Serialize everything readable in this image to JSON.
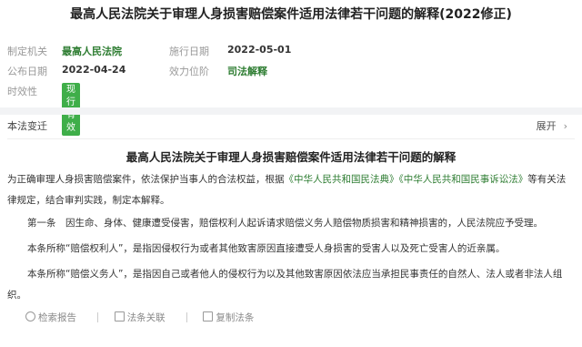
{
  "header": {
    "title": "最高人民法院关于审理人身损害赔偿案件适用法律若干问题的解释(2022修正)"
  },
  "meta": {
    "issuer_label": "制定机关",
    "issuer": "最高人民法院",
    "effective_label": "施行日期",
    "effective": "2022-05-01",
    "publish_label": "公布日期",
    "publish": "2022-04-24",
    "level_label": "效力位阶",
    "level": "司法解释",
    "validity_label": "时效性",
    "validity": "现行有效"
  },
  "changes": {
    "label": "本法变迁",
    "expand_label": "展开",
    "chevron": "›"
  },
  "document": {
    "title": "最高人民法院关于审理人身损害赔偿案件适用法律若干问题的解释",
    "preamble_a": "为正确审理人身损害赔偿案件，依法保护当事人的合法权益，根据",
    "law1": "《中华人民共和国民法典》",
    "law2": "《中华人民共和国民事诉讼法》",
    "preamble_b": "等有关法律规定，结合审判实践，制定本解释。",
    "article1": "第一条　因生命、身体、健康遭受侵害，赔偿权利人起诉请求赔偿义务人赔偿物质损害和精神损害的，人民法院应予受理。",
    "para2": "本条所称“赔偿权利人”，是指因侵权行为或者其他致害原因直接遭受人身损害的受害人以及死亡受害人的近亲属。",
    "para3": "本条所称“赔偿义务人”，是指因自己或者他人的侵权行为以及其他致害原因依法应当承担民事责任的自然人、法人或者非法人组织。"
  },
  "actions": {
    "search_report": "检索报告",
    "related": "法条关联",
    "copy": "复制法条"
  },
  "colors": {
    "accent": "#2e7d32",
    "badge": "#3fae49"
  }
}
